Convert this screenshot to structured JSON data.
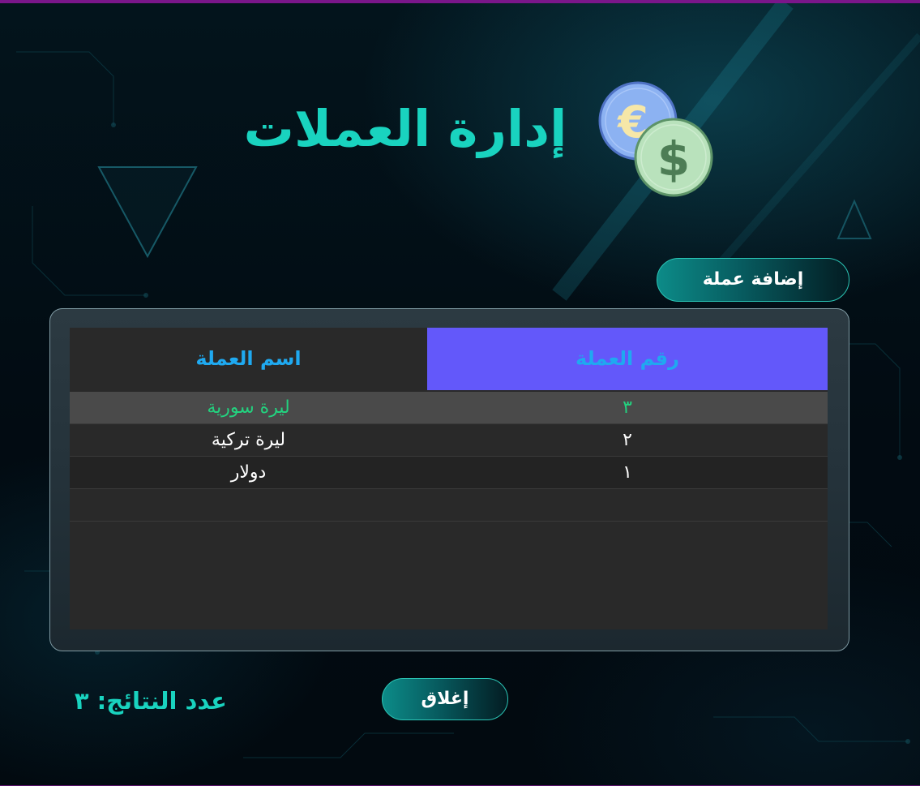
{
  "header": {
    "title": "إدارة العملات",
    "icons": [
      "euro-coin-icon",
      "dollar-coin-icon"
    ],
    "euro_symbol": "€",
    "dollar_symbol": "$"
  },
  "toolbar": {
    "add_label": "إضافة عملة"
  },
  "table": {
    "columns": {
      "name": "اسم العملة",
      "id": "رقم العملة"
    },
    "rows": [
      {
        "id": "٣",
        "name": "ليرة سورية",
        "selected": true
      },
      {
        "id": "٢",
        "name": "ليرة تركية",
        "selected": false
      },
      {
        "id": "١",
        "name": "دولار",
        "selected": false
      }
    ]
  },
  "footer": {
    "results_count": "عدد النتائج: ٣",
    "close_label": "إغلاق"
  },
  "colors": {
    "accent": "#19d3bf",
    "header_highlight": "#6358fa",
    "header_text": "#1fa9f0",
    "selected_text": "#23d27f",
    "top_border": "#7a168a"
  }
}
